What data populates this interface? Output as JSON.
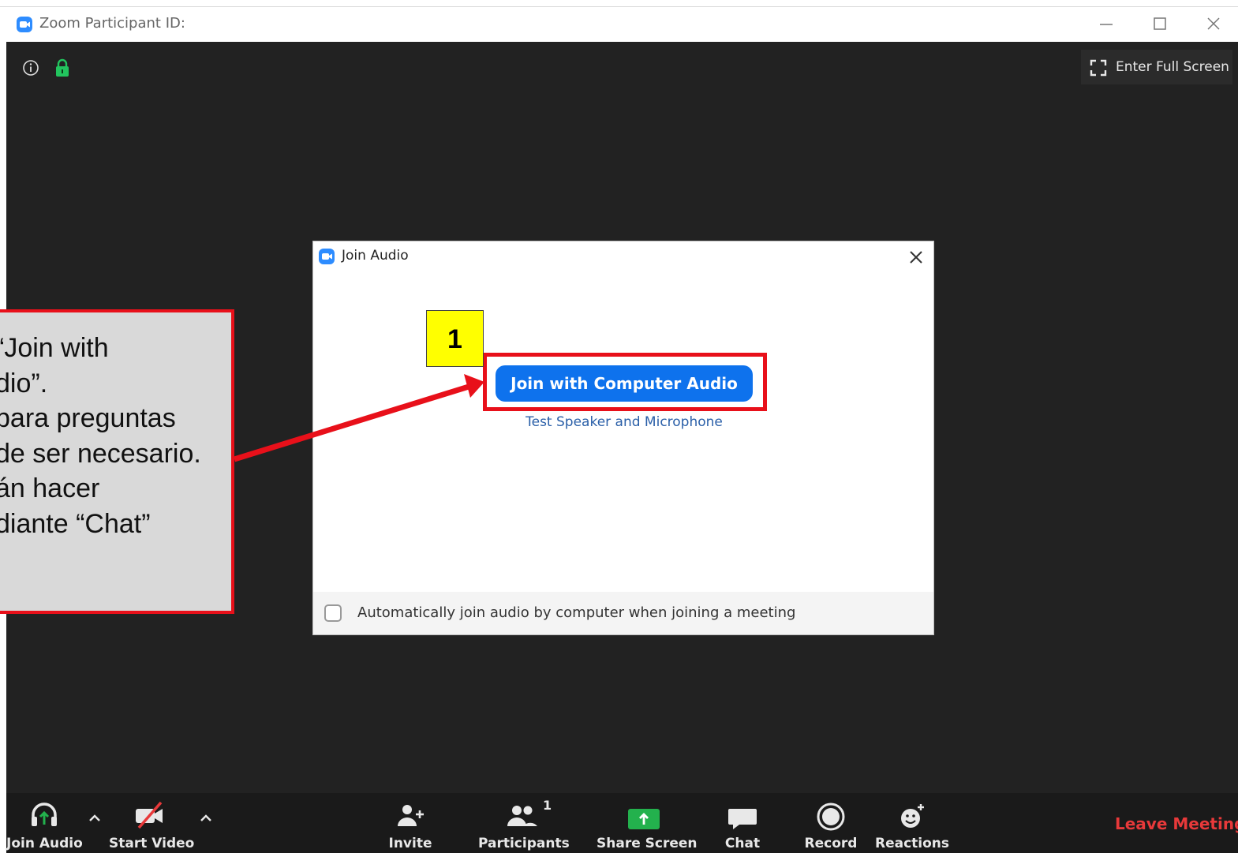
{
  "window": {
    "title": "Zoom Participant ID:",
    "minimize_icon": "minimize-icon",
    "maximize_icon": "maximize-icon",
    "close_icon": "close-icon"
  },
  "meeting": {
    "fullscreen_label": "Enter Full Screen"
  },
  "dialog": {
    "title": "Join Audio",
    "join_button": "Join with Computer Audio",
    "test_link": "Test Speaker and Microphone",
    "auto_join_label": "Automatically join audio by computer when joining a meeting",
    "auto_join_checked": false
  },
  "annotation": {
    "step_number": "1",
    "highlight_color": "#e8101a",
    "callout_lines": [
      "“Join with",
      "dio”.",
      "  para preguntas",
      "de ser necesario.",
      "án hacer",
      "diante “Chat”"
    ]
  },
  "toolbar": {
    "join_audio": "Join Audio",
    "start_video": "Start Video",
    "invite": "Invite",
    "participants": "Participants",
    "participants_count": "1",
    "share_screen": "Share Screen",
    "chat": "Chat",
    "record": "Record",
    "reactions": "Reactions",
    "leave": "Leave Meeting"
  },
  "colors": {
    "zoom_blue": "#0e72ed",
    "share_green": "#23b14d",
    "leave_red": "#e8393a",
    "lock_green": "#22c55e"
  }
}
